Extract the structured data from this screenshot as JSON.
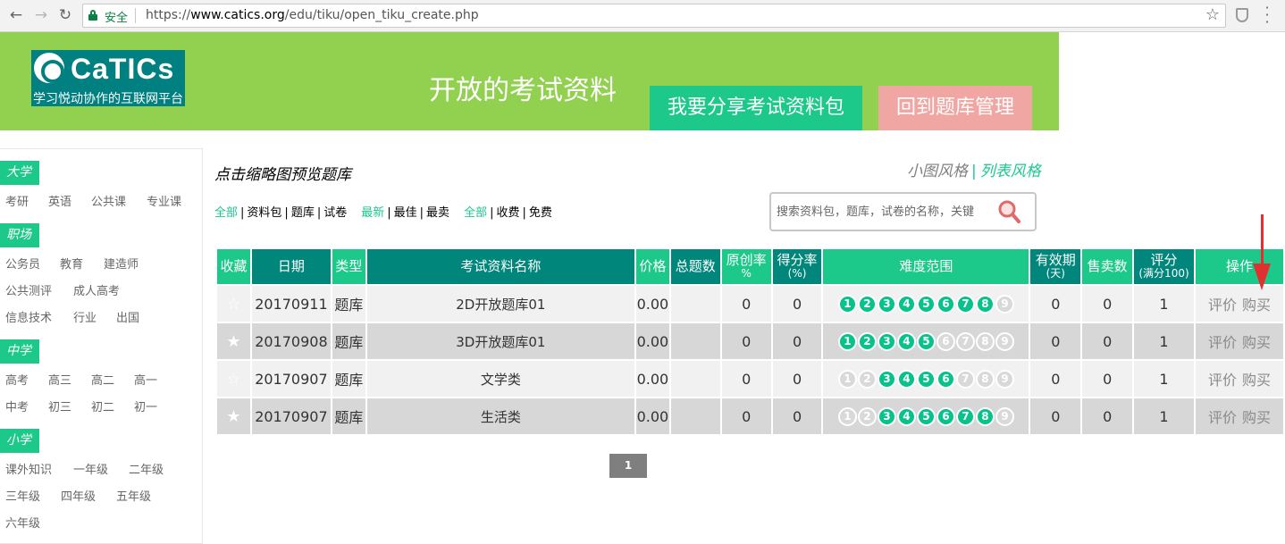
{
  "browser": {
    "secure_label": "安全",
    "url_scheme": "https://",
    "url_host": "www.catics.org",
    "url_path": "/edu/tiku/open_tiku_create.php"
  },
  "banner": {
    "logo_name": "CaTICs",
    "logo_tagline": "学习悦动协作的互联网平台",
    "title": "开放的考试资料",
    "share_button": "我要分享考试资料包",
    "back_button": "回到题库管理"
  },
  "sidebar": {
    "categories": [
      {
        "label": "大学",
        "items": [
          "考研",
          "英语",
          "公共课",
          "专业课"
        ]
      },
      {
        "label": "职场",
        "items": [
          "公务员",
          "教育",
          "建造师",
          "公共测评",
          "成人高考",
          "信息技术",
          "行业",
          "出国"
        ]
      },
      {
        "label": "中学",
        "items": [
          "高考",
          "高三",
          "高二",
          "高一",
          "中考",
          "初三",
          "初二",
          "初一"
        ]
      },
      {
        "label": "小学",
        "items": [
          "课外知识",
          "一年级",
          "二年级",
          "三年级",
          "四年级",
          "五年级",
          "六年级"
        ]
      }
    ]
  },
  "main": {
    "heading": "点击缩略图预览题库",
    "view_small": "小图风格",
    "view_sep": "|",
    "view_list": "列表风格",
    "filters": {
      "type": [
        "全部",
        "资料包",
        "题库",
        "试卷"
      ],
      "sort": [
        "最新",
        "最佳",
        "最卖"
      ],
      "price": [
        "全部",
        "收费",
        "免费"
      ]
    },
    "search_placeholder": "搜索资料包，题库，试卷的名称，关键"
  },
  "table": {
    "headers": {
      "fav": "收藏",
      "date": "日期",
      "type": "类型",
      "name": "考试资料名称",
      "price": "价格",
      "total": "总题数",
      "orig": "原创率",
      "orig_unit": "%",
      "score": "得分率",
      "score_unit": "(%)",
      "diff": "难度范围",
      "valid": "有效期",
      "valid_unit": "(天)",
      "sales": "售卖数",
      "rating": "评分",
      "rating_unit": "(满分100)",
      "ops": "操作"
    },
    "rows": [
      {
        "fav": "☆",
        "date": "20170911",
        "type": "题库",
        "name": "2D开放题库01",
        "price": "0.00",
        "total": "",
        "orig": "0",
        "score": "0",
        "diff": [
          1,
          1,
          1,
          1,
          1,
          1,
          1,
          1,
          0
        ],
        "valid": "0",
        "sales": "0",
        "rating": "1",
        "op1": "评价",
        "op2": "购买"
      },
      {
        "fav": "★",
        "date": "20170908",
        "type": "题库",
        "name": "3D开放题库01",
        "price": "0.00",
        "total": "",
        "orig": "0",
        "score": "0",
        "diff": [
          1,
          1,
          1,
          1,
          1,
          0,
          0,
          0,
          0
        ],
        "valid": "0",
        "sales": "0",
        "rating": "1",
        "op1": "评价",
        "op2": "购买"
      },
      {
        "fav": "☆",
        "date": "20170907",
        "type": "题库",
        "name": "文学类",
        "price": "0.00",
        "total": "",
        "orig": "0",
        "score": "0",
        "diff": [
          0,
          0,
          1,
          1,
          1,
          1,
          0,
          0,
          0
        ],
        "valid": "0",
        "sales": "0",
        "rating": "1",
        "op1": "评价",
        "op2": "购买"
      },
      {
        "fav": "★",
        "date": "20170907",
        "type": "题库",
        "name": "生活类",
        "price": "0.00",
        "total": "",
        "orig": "0",
        "score": "0",
        "diff": [
          0,
          0,
          1,
          1,
          1,
          1,
          1,
          1,
          0
        ],
        "valid": "0",
        "sales": "0",
        "rating": "1",
        "op1": "评价",
        "op2": "购买"
      }
    ],
    "difficulty_labels": [
      "1",
      "2",
      "3",
      "4",
      "5",
      "6",
      "7",
      "8",
      "9"
    ]
  },
  "pagination": {
    "current": "1"
  },
  "colors": {
    "accent": "#1cc88a",
    "header_dark": "#00867a",
    "banner": "#92d050",
    "back_button": "#f0a7a4",
    "annotation_arrow": "#e03131"
  }
}
